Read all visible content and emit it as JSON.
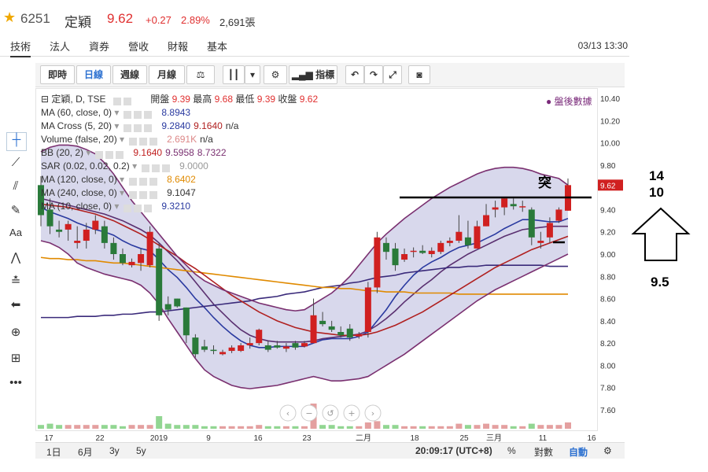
{
  "header": {
    "star_icon": "star-icon",
    "code": "6251",
    "name": "定穎",
    "price": "9.62",
    "change": "+0.27",
    "percent": "2.89%",
    "volume": "2,691張"
  },
  "tabs": [
    {
      "label": "技術",
      "active": true
    },
    {
      "label": "法人",
      "active": false
    },
    {
      "label": "資券",
      "active": false
    },
    {
      "label": "營收",
      "active": false
    },
    {
      "label": "財報",
      "active": false
    },
    {
      "label": "基本",
      "active": false
    }
  ],
  "datetime": "03/13 13:30",
  "toolbar": {
    "intraday": "即時",
    "daily": "日線",
    "weekly": "週線",
    "monthly": "月線",
    "indicators": "指標"
  },
  "legend": {
    "main": {
      "label": "定穎, D, TSE",
      "open_label": "開盤",
      "open": "9.39",
      "high_label": "最高",
      "high": "9.68",
      "low_label": "最低",
      "low": "9.39",
      "close_label": "收盤",
      "close": "9.62"
    },
    "rows": [
      {
        "name": "MA (60, close, 0)",
        "values": [
          "8.8943"
        ],
        "colors": [
          "#2a3aa0"
        ]
      },
      {
        "name": "MA Cross (5, 20)",
        "values": [
          "9.2840",
          "9.1640",
          "n/a"
        ],
        "colors": [
          "#2a3aa0",
          "#b02020",
          "#333"
        ]
      },
      {
        "name": "Volume (false, 20)",
        "values": [
          "2.691K",
          "n/a"
        ],
        "colors": [
          "#d88",
          "#333"
        ]
      },
      {
        "name": "BB (20, 2)",
        "values": [
          "9.1640",
          "9.5958",
          "8.7322"
        ],
        "colors": [
          "#c02020",
          "#7a3070",
          "#7a3070"
        ]
      },
      {
        "name": "SAR (0.02, 0.02, 0.2)",
        "values": [
          "9.0000"
        ],
        "colors": [
          "#999"
        ]
      },
      {
        "name": "MA (120, close, 0)",
        "values": [
          "8.6402"
        ],
        "colors": [
          "#e08a00"
        ]
      },
      {
        "name": "MA (240, close, 0)",
        "values": [
          "9.1047"
        ],
        "colors": [
          "#333"
        ]
      },
      {
        "name": "MA (10, close, 0)",
        "values": [
          "9.3210"
        ],
        "colors": [
          "#2a3aa0"
        ]
      }
    ]
  },
  "after_hours": "● 盤後數據",
  "annotation": {
    "breakout": "突",
    "a": "14",
    "b": "10",
    "c": "9.5"
  },
  "axis": {
    "y_ticks": [
      "10.40",
      "10.20",
      "10.00",
      "9.80",
      "9.60",
      "9.40",
      "9.20",
      "9.00",
      "8.80",
      "8.60",
      "8.40",
      "8.20",
      "8.00",
      "7.80",
      "7.60"
    ],
    "x_ticks": [
      "17",
      "22",
      "2019",
      "9",
      "16",
      "23",
      "二月",
      "18",
      "25",
      "三月",
      "11",
      "16"
    ],
    "price_tag": "9.62"
  },
  "chart_data": {
    "type": "candlestick",
    "ylim": [
      7.5,
      10.5
    ],
    "candles": [
      {
        "o": 9.62,
        "h": 9.7,
        "l": 9.25,
        "c": 9.35
      },
      {
        "o": 9.4,
        "h": 9.5,
        "l": 9.18,
        "c": 9.25
      },
      {
        "o": 9.22,
        "h": 9.3,
        "l": 9.15,
        "c": 9.2
      },
      {
        "o": 9.22,
        "h": 9.3,
        "l": 9.12,
        "c": 9.27
      },
      {
        "o": 9.1,
        "h": 9.25,
        "l": 9.05,
        "c": 9.12
      },
      {
        "o": 9.12,
        "h": 9.28,
        "l": 9.05,
        "c": 9.22
      },
      {
        "o": 9.22,
        "h": 9.35,
        "l": 9.18,
        "c": 9.3
      },
      {
        "o": 9.25,
        "h": 9.3,
        "l": 9.05,
        "c": 9.1
      },
      {
        "o": 9.1,
        "h": 9.15,
        "l": 8.95,
        "c": 9.0
      },
      {
        "o": 9.0,
        "h": 9.05,
        "l": 8.9,
        "c": 8.92
      },
      {
        "o": 8.9,
        "h": 8.96,
        "l": 8.88,
        "c": 8.93
      },
      {
        "o": 8.92,
        "h": 9.05,
        "l": 8.85,
        "c": 9.0
      },
      {
        "o": 8.9,
        "h": 9.25,
        "l": 8.88,
        "c": 9.2
      },
      {
        "o": 9.05,
        "h": 9.1,
        "l": 8.4,
        "c": 8.45
      },
      {
        "o": 8.55,
        "h": 8.62,
        "l": 8.45,
        "c": 8.5
      },
      {
        "o": 8.6,
        "h": 8.6,
        "l": 8.52,
        "c": 8.53
      },
      {
        "o": 8.52,
        "h": 8.52,
        "l": 8.2,
        "c": 8.27
      },
      {
        "o": 8.25,
        "h": 8.28,
        "l": 8.07,
        "c": 8.1
      },
      {
        "o": 8.17,
        "h": 8.23,
        "l": 8.12,
        "c": 8.14
      },
      {
        "o": 8.14,
        "h": 8.18,
        "l": 8.1,
        "c": 8.13
      },
      {
        "o": 8.1,
        "h": 8.14,
        "l": 8.09,
        "c": 8.12
      },
      {
        "o": 8.13,
        "h": 8.18,
        "l": 8.11,
        "c": 8.16
      },
      {
        "o": 8.13,
        "h": 8.2,
        "l": 8.12,
        "c": 8.18
      },
      {
        "o": 8.18,
        "h": 8.25,
        "l": 8.15,
        "c": 8.2
      },
      {
        "o": 8.2,
        "h": 8.33,
        "l": 8.18,
        "c": 8.32
      },
      {
        "o": 8.18,
        "h": 8.22,
        "l": 8.12,
        "c": 8.14
      },
      {
        "o": 8.18,
        "h": 8.22,
        "l": 8.15,
        "c": 8.16
      },
      {
        "o": 8.15,
        "h": 8.2,
        "l": 8.12,
        "c": 8.17
      },
      {
        "o": 8.2,
        "h": 8.22,
        "l": 8.14,
        "c": 8.16
      },
      {
        "o": 8.17,
        "h": 8.22,
        "l": 8.16,
        "c": 8.2
      },
      {
        "o": 8.2,
        "h": 8.6,
        "l": 8.2,
        "c": 8.45
      },
      {
        "o": 8.4,
        "h": 8.48,
        "l": 8.35,
        "c": 8.37
      },
      {
        "o": 8.35,
        "h": 8.4,
        "l": 8.3,
        "c": 8.32
      },
      {
        "o": 8.3,
        "h": 8.35,
        "l": 8.25,
        "c": 8.27
      },
      {
        "o": 8.33,
        "h": 8.37,
        "l": 8.22,
        "c": 8.25
      },
      {
        "o": 8.26,
        "h": 8.3,
        "l": 8.24,
        "c": 8.28
      },
      {
        "o": 8.3,
        "h": 8.75,
        "l": 8.25,
        "c": 8.7
      },
      {
        "o": 8.7,
        "h": 9.2,
        "l": 8.65,
        "c": 9.15
      },
      {
        "o": 9.1,
        "h": 9.15,
        "l": 8.95,
        "c": 9.02
      },
      {
        "o": 9.05,
        "h": 9.1,
        "l": 8.85,
        "c": 8.9
      },
      {
        "o": 8.95,
        "h": 9.05,
        "l": 8.93,
        "c": 9.0
      },
      {
        "o": 9.02,
        "h": 9.06,
        "l": 8.97,
        "c": 9.03
      },
      {
        "o": 9.03,
        "h": 9.08,
        "l": 9.0,
        "c": 9.01
      },
      {
        "o": 9.0,
        "h": 9.06,
        "l": 8.97,
        "c": 9.03
      },
      {
        "o": 9.02,
        "h": 9.12,
        "l": 9.0,
        "c": 9.1
      },
      {
        "o": 9.1,
        "h": 9.15,
        "l": 9.07,
        "c": 9.12
      },
      {
        "o": 9.12,
        "h": 9.35,
        "l": 9.1,
        "c": 9.2
      },
      {
        "o": 9.15,
        "h": 9.3,
        "l": 9.05,
        "c": 9.08
      },
      {
        "o": 9.05,
        "h": 9.3,
        "l": 9.05,
        "c": 9.25
      },
      {
        "o": 9.25,
        "h": 9.45,
        "l": 9.25,
        "c": 9.35
      },
      {
        "o": 9.4,
        "h": 9.48,
        "l": 9.33,
        "c": 9.42
      },
      {
        "o": 9.42,
        "h": 9.5,
        "l": 9.35,
        "c": 9.5
      },
      {
        "o": 9.45,
        "h": 9.5,
        "l": 9.4,
        "c": 9.43
      },
      {
        "o": 9.42,
        "h": 9.48,
        "l": 9.38,
        "c": 9.43
      },
      {
        "o": 9.4,
        "h": 9.42,
        "l": 9.08,
        "c": 9.15
      },
      {
        "o": 9.1,
        "h": 9.2,
        "l": 9.05,
        "c": 9.12
      },
      {
        "o": 9.15,
        "h": 9.33,
        "l": 9.1,
        "c": 9.28
      },
      {
        "o": 9.3,
        "h": 9.42,
        "l": 9.28,
        "c": 9.4
      },
      {
        "o": 9.39,
        "h": 9.68,
        "l": 9.39,
        "c": 9.62
      }
    ],
    "volume": [
      0.3,
      0.4,
      0.3,
      0.3,
      0.3,
      0.3,
      0.3,
      0.3,
      0.3,
      0.2,
      0.3,
      0.3,
      0.3,
      1.0,
      0.4,
      0.3,
      0.3,
      0.3,
      0.2,
      0.2,
      0.2,
      0.2,
      0.2,
      0.2,
      0.3,
      0.2,
      0.2,
      0.2,
      0.2,
      0.2,
      2.0,
      0.3,
      0.3,
      0.2,
      0.2,
      0.2,
      0.5,
      0.6,
      0.3,
      0.3,
      0.2,
      0.2,
      0.2,
      0.2,
      0.2,
      0.2,
      0.4,
      0.3,
      0.3,
      0.4,
      0.3,
      0.3,
      0.2,
      0.2,
      0.4,
      0.3,
      0.3,
      0.3,
      0.5
    ],
    "series": [
      {
        "name": "MA (10, close, 0)",
        "color": "#2a3aa0",
        "values": [
          9.42,
          9.38,
          9.35,
          9.32,
          9.28,
          9.25,
          9.22,
          9.2,
          9.17,
          9.12,
          9.08,
          9.05,
          9.03,
          8.95,
          8.86,
          8.79,
          8.7,
          8.6,
          8.52,
          8.43,
          8.35,
          8.28,
          8.22,
          8.18,
          8.16,
          8.16,
          8.17,
          8.17,
          8.17,
          8.17,
          8.2,
          8.23,
          8.24,
          8.24,
          8.24,
          8.26,
          8.3,
          8.4,
          8.5,
          8.62,
          8.72,
          8.81,
          8.88,
          8.93,
          8.97,
          9.02,
          9.06,
          9.08,
          9.1,
          9.14,
          9.18,
          9.23,
          9.27,
          9.31,
          9.31,
          9.3,
          9.29,
          9.29,
          9.32
        ]
      },
      {
        "name": "MA (20)",
        "color": "#5a3070",
        "values": [
          9.5,
          9.48,
          9.46,
          9.44,
          9.42,
          9.4,
          9.38,
          9.36,
          9.33,
          9.3,
          9.26,
          9.22,
          9.17,
          9.1,
          9.02,
          8.94,
          8.85,
          8.75,
          8.65,
          8.55,
          8.47,
          8.39,
          8.32,
          8.27,
          8.24,
          8.22,
          8.21,
          8.21,
          8.21,
          8.21,
          8.22,
          8.24,
          8.25,
          8.26,
          8.27,
          8.28,
          8.31,
          8.36,
          8.42,
          8.49,
          8.57,
          8.64,
          8.71,
          8.77,
          8.84,
          8.9,
          8.95,
          9.0,
          9.04,
          9.08,
          9.12,
          9.16,
          9.19,
          9.22,
          9.23,
          9.24,
          9.25,
          9.25,
          9.25
        ]
      },
      {
        "name": "MA (60, close, 0)",
        "color": "#3a2a7a",
        "values": [
          8.43,
          8.43,
          8.43,
          8.43,
          8.44,
          8.44,
          8.44,
          8.45,
          8.45,
          8.46,
          8.46,
          8.47,
          8.48,
          8.48,
          8.49,
          8.5,
          8.51,
          8.52,
          8.53,
          8.54,
          8.55,
          8.56,
          8.57,
          8.58,
          8.6,
          8.61,
          8.62,
          8.64,
          8.65,
          8.66,
          8.68,
          8.7,
          8.71,
          8.72,
          8.74,
          8.75,
          8.77,
          8.79,
          8.8,
          8.81,
          8.83,
          8.84,
          8.85,
          8.86,
          8.87,
          8.88,
          8.88,
          8.89,
          8.89,
          8.9,
          8.9,
          8.9,
          8.9,
          8.9,
          8.9,
          8.9,
          8.89,
          8.89,
          8.89
        ]
      },
      {
        "name": "MA (120, close, 0)",
        "color": "#e08a00",
        "values": [
          8.97,
          8.96,
          8.96,
          8.95,
          8.95,
          8.94,
          8.94,
          8.93,
          8.92,
          8.92,
          8.91,
          8.9,
          8.89,
          8.88,
          8.87,
          8.86,
          8.85,
          8.84,
          8.83,
          8.82,
          8.81,
          8.8,
          8.79,
          8.78,
          8.77,
          8.76,
          8.75,
          8.74,
          8.73,
          8.72,
          8.71,
          8.7,
          8.7,
          8.69,
          8.69,
          8.68,
          8.67,
          8.67,
          8.66,
          8.66,
          8.66,
          8.65,
          8.65,
          8.65,
          8.65,
          8.65,
          8.64,
          8.64,
          8.64,
          8.64,
          8.64,
          8.64,
          8.64,
          8.64,
          8.64,
          8.64,
          8.64,
          8.64,
          8.64
        ]
      },
      {
        "name": "MA (240, close, 0)",
        "color": "#b02020",
        "values": [
          9.45,
          9.44,
          9.43,
          9.42,
          9.4,
          9.38,
          9.36,
          9.33,
          9.3,
          9.26,
          9.22,
          9.18,
          9.13,
          9.08,
          9.03,
          8.98,
          8.92,
          8.87,
          8.81,
          8.75,
          8.69,
          8.63,
          8.58,
          8.53,
          8.48,
          8.44,
          8.4,
          8.37,
          8.34,
          8.32,
          8.3,
          8.29,
          8.28,
          8.27,
          8.27,
          8.27,
          8.28,
          8.3,
          8.33,
          8.36,
          8.4,
          8.44,
          8.48,
          8.53,
          8.58,
          8.63,
          8.68,
          8.73,
          8.78,
          8.83,
          8.88,
          8.92,
          8.96,
          9.0,
          9.04,
          9.07,
          9.1,
          9.13,
          9.16
        ]
      },
      {
        "name": "BB upper",
        "color": "#7a3070",
        "values": [
          9.92,
          9.96,
          9.98,
          9.98,
          9.97,
          9.94,
          9.9,
          9.82,
          9.72,
          9.6,
          9.48,
          9.38,
          9.28,
          9.18,
          9.08,
          8.98,
          8.9,
          8.82,
          8.76,
          8.72,
          8.68,
          8.65,
          8.62,
          8.59,
          8.56,
          8.54,
          8.52,
          8.5,
          8.49,
          8.5,
          8.55,
          8.6,
          8.65,
          8.72,
          8.8,
          8.9,
          9.0,
          9.1,
          9.18,
          9.25,
          9.32,
          9.38,
          9.44,
          9.5,
          9.55,
          9.6,
          9.64,
          9.68,
          9.72,
          9.75,
          9.77,
          9.78,
          9.78,
          9.77,
          9.75,
          9.72,
          9.7,
          9.68,
          9.62
        ]
      },
      {
        "name": "BB lower",
        "color": "#7a3070",
        "values": [
          9.12,
          9.1,
          9.06,
          9.0,
          8.92,
          8.88,
          8.85,
          8.82,
          8.8,
          8.78,
          8.76,
          8.72,
          8.65,
          8.55,
          8.42,
          8.3,
          8.18,
          8.06,
          7.96,
          7.9,
          7.86,
          7.82,
          7.8,
          7.79,
          7.8,
          7.81,
          7.82,
          7.84,
          7.86,
          7.88,
          7.9,
          7.88,
          7.86,
          7.86,
          7.87,
          7.88,
          7.9,
          7.95,
          8.0,
          8.05,
          8.1,
          8.16,
          8.22,
          8.28,
          8.34,
          8.4,
          8.46,
          8.52,
          8.58,
          8.63,
          8.68,
          8.72,
          8.76,
          8.8,
          8.84,
          8.88,
          8.92,
          8.96,
          9.0
        ]
      }
    ]
  }
}
